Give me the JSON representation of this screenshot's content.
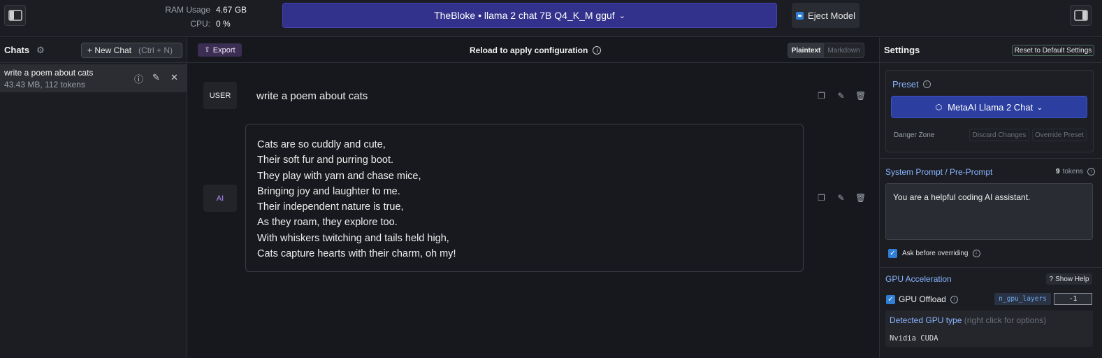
{
  "topbar": {
    "ram_label": "RAM Usage",
    "ram_value": "4.67 GB",
    "cpu_label": "CPU:",
    "cpu_value": "0 %",
    "model_name": "TheBloke • llama 2 chat 7B Q4_K_M gguf",
    "eject_label": "Eject Model"
  },
  "sidebar": {
    "title": "Chats",
    "new_chat_label": "+ New Chat",
    "new_chat_shortcut": "(Ctrl + N)",
    "chats": [
      {
        "title": "write a poem about cats",
        "meta": "43.43 MB, 112 tokens"
      }
    ]
  },
  "chat": {
    "export_label": "Export",
    "banner": "Reload to apply configuration",
    "view_modes": [
      "Plaintext",
      "Markdown"
    ],
    "active_view": "Plaintext",
    "messages": [
      {
        "role": "USER",
        "text": "write a poem about cats"
      },
      {
        "role": "AI",
        "lines": [
          "Cats are so cuddly and cute,",
          "Their soft fur and purring boot.",
          "They play with yarn and chase mice,",
          "Bringing joy and laughter to me.",
          "Their independent nature is true,",
          "As they roam, they explore too.",
          "With whiskers twitching and tails held high,",
          "Cats capture hearts with their charm, oh my!"
        ]
      }
    ]
  },
  "settings": {
    "title": "Settings",
    "reset_label": "Reset to Default Settings",
    "preset_label": "Preset",
    "preset_value": "MetaAI Llama 2 Chat",
    "danger_zone_label": "Danger Zone",
    "discard_label": "Discard Changes",
    "override_label": "Override Preset",
    "system_prompt_label": "System Prompt / Pre-Prompt",
    "system_prompt_tokens": "9",
    "tokens_word": "tokens",
    "system_prompt_text": "You are a helpful coding AI assistant.",
    "ask_before_overriding": "Ask before overriding",
    "gpu_section_label": "GPU Acceleration",
    "show_help_label": "Show Help",
    "gpu_offload_label": "GPU Offload",
    "n_gpu_layers_label": "n_gpu_layers",
    "n_gpu_layers_value": "-1",
    "detected_gpu_label": "Detected GPU type",
    "detected_gpu_hint": "(right click for options)",
    "detected_gpu_value": "Nvidia CUDA"
  }
}
